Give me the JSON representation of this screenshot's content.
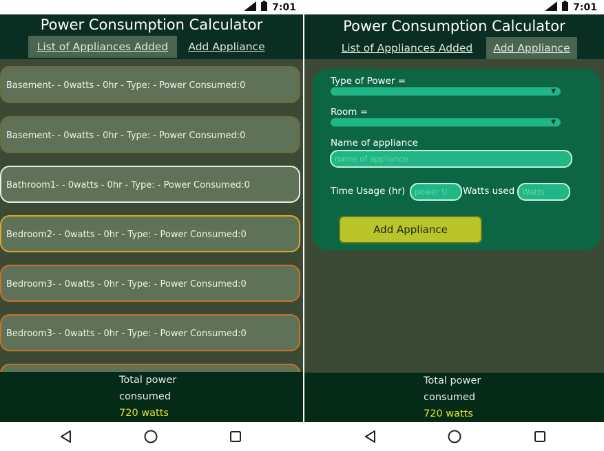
{
  "status": {
    "time": "7:01"
  },
  "app": {
    "title": "Power Consumption Calculator",
    "tabs": {
      "list": "List of Appliances Added",
      "add": "Add Appliance"
    }
  },
  "list_screen": {
    "active_tab": "list",
    "items": [
      {
        "text": "Basement- - 0watts - 0hr - Type: - Power Consumed:0",
        "border": "#6f6b3c"
      },
      {
        "text": "Basement- - 0watts - 0hr - Type: - Power Consumed:0",
        "border": "#6f6b3c"
      },
      {
        "text": "Bathroom1- - 0watts - 0hr - Type: - Power Consumed:0",
        "border": "#e9eee6"
      },
      {
        "text": "Bedroom2- - 0watts - 0hr - Type: - Power Consumed:0",
        "border": "#d9a92a"
      },
      {
        "text": "Bedroom3- - 0watts - 0hr - Type: - Power Consumed:0",
        "border": "#c9702c"
      },
      {
        "text": "Bedroom3- - 0watts - 0hr - Type: - Power Consumed:0",
        "border": "#c9702c"
      },
      {
        "text": "",
        "border": "#c9702c"
      }
    ]
  },
  "add_screen": {
    "active_tab": "add",
    "form": {
      "type_of_power_label": "Type of Power =",
      "room_label": "Room =",
      "name_label": "Name of appliance",
      "name_placeholder": "name of appliance",
      "time_label": "Time Usage (hr)",
      "time_placeholder": "power U",
      "watts_label": "Watts used",
      "watts_placeholder": "Watts",
      "submit_label": "Add Appliance"
    }
  },
  "footer": {
    "line1": "Total power",
    "line2": "consumed",
    "value": "720 watts"
  }
}
